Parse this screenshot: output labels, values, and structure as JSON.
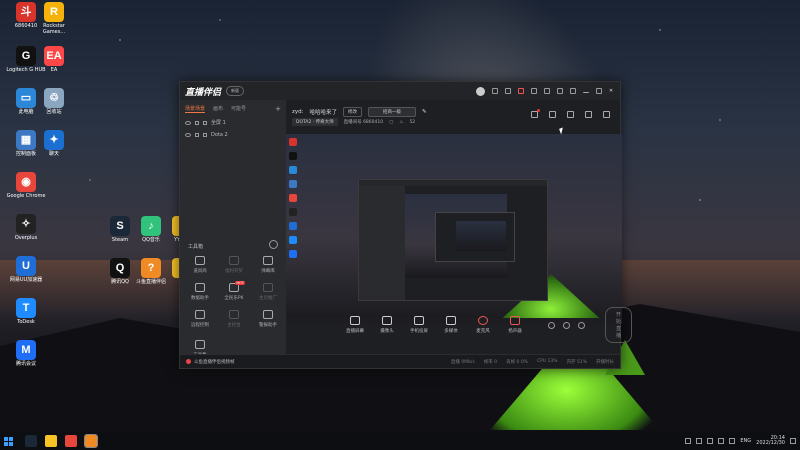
{
  "desktop": {
    "icons": [
      {
        "label": "6860410",
        "name": "desktop-icon-6860410",
        "color": "#d8342c",
        "glyph": "斗"
      },
      {
        "label": "Rockstar Games...",
        "name": "desktop-icon-rockstar",
        "color": "#f4b20b",
        "glyph": "R"
      },
      {
        "label": "Logitech G HUB",
        "name": "desktop-icon-logitech",
        "color": "#111111",
        "glyph": "G"
      },
      {
        "label": "EA",
        "name": "desktop-icon-ea",
        "color": "#ff4747",
        "glyph": "EA"
      },
      {
        "label": "此电脑",
        "name": "desktop-icon-this-pc",
        "color": "#2b88d8",
        "glyph": "▭"
      },
      {
        "label": "回收站",
        "name": "desktop-icon-recycle-bin",
        "color": "#8aa6c1",
        "glyph": "♲"
      },
      {
        "label": "控制面板",
        "name": "desktop-icon-control-panel",
        "color": "#3c78c3",
        "glyph": "▦"
      },
      {
        "label": "聊天",
        "name": "desktop-icon-chat",
        "color": "#1a6fd1",
        "glyph": "✦"
      },
      {
        "label": "Google Chrome",
        "name": "desktop-icon-chrome",
        "color": "#e8453c",
        "glyph": "◉"
      },
      {
        "label": "Overplus",
        "name": "desktop-icon-overplus",
        "color": "#222222",
        "glyph": "✧"
      },
      {
        "label": "网易UU加速器",
        "name": "desktop-icon-uu",
        "color": "#1f6dd6",
        "glyph": "U"
      },
      {
        "label": "ToDesk",
        "name": "desktop-icon-todesk",
        "color": "#1e8bff",
        "glyph": "T"
      },
      {
        "label": "腾讯会议",
        "name": "desktop-icon-tencent-meeting",
        "color": "#1f6ef5",
        "glyph": "M"
      },
      {
        "label": "Steam",
        "name": "desktop-icon-steam",
        "color": "#1b2838",
        "glyph": "S"
      },
      {
        "label": "QQ音乐",
        "name": "desktop-icon-qq-music",
        "color": "#31c27c",
        "glyph": "♪"
      },
      {
        "label": "YY语音",
        "name": "desktop-icon-yy",
        "color": "#f7c325",
        "glyph": "Y"
      },
      {
        "label": "腾讯QQ",
        "name": "desktop-icon-qq",
        "color": "#111111",
        "glyph": "Q"
      },
      {
        "label": "斗鱼直播伴侣",
        "name": "desktop-icon-douyu",
        "color": "#f08a24",
        "glyph": "?"
      },
      {
        "label": "Y",
        "name": "desktop-icon-y",
        "color": "#f7c325",
        "glyph": "Y"
      }
    ]
  },
  "app": {
    "title": "直播伴侣",
    "badge": "新版",
    "left_tabs": [
      "场景场景",
      "画布",
      "可能号"
    ],
    "add_label": "+",
    "scenes": [
      "全屏 1",
      "Dota 2"
    ],
    "tools_header": "工具箱",
    "tools": [
      {
        "label": "道具商",
        "name": "tool-props"
      },
      {
        "label": "福利开奖",
        "name": "tool-lottery"
      },
      {
        "label": "弹幕库",
        "name": "tool-danmu"
      },
      {
        "label": "数据助手",
        "name": "tool-data"
      },
      {
        "label": "全民乐PK",
        "name": "tool-pk",
        "hot": "HOT"
      },
      {
        "label": "主页推广",
        "name": "tool-promo"
      },
      {
        "label": "远程控制",
        "name": "tool-remote"
      },
      {
        "label": "主控台",
        "name": "tool-console"
      },
      {
        "label": "警报助手",
        "name": "tool-alert"
      },
      {
        "label": "工具集",
        "name": "tool-set"
      }
    ],
    "room": {
      "streamer": "zyd:",
      "room_title": "哈哈哈来了",
      "edit_label": "修改",
      "category_label": "招商一级",
      "game": "DOTA2 · 传奇大师",
      "room_id_label": "直播间号 6860410",
      "viewers": "52"
    },
    "controls": [
      {
        "label": "直播屏幕",
        "name": "control-screen"
      },
      {
        "label": "摄像头",
        "name": "control-camera"
      },
      {
        "label": "手机投屏",
        "name": "control-phone"
      },
      {
        "label": "多媒体",
        "name": "control-media"
      },
      {
        "label": "麦克风",
        "name": "control-mic"
      },
      {
        "label": "扬声器",
        "name": "control-speaker"
      }
    ],
    "start_label": "开始直播",
    "status_warning": "斗鱼直播伴侣视频帧",
    "stats": [
      "直播 0Mb/s",
      "帧率 0",
      "丢帧 0.0%",
      "CPU 13%",
      "内存 51%",
      "开播时长"
    ]
  },
  "taskbar": {
    "lang": "ENG",
    "time": "20:14",
    "date": "2022/12/30"
  }
}
